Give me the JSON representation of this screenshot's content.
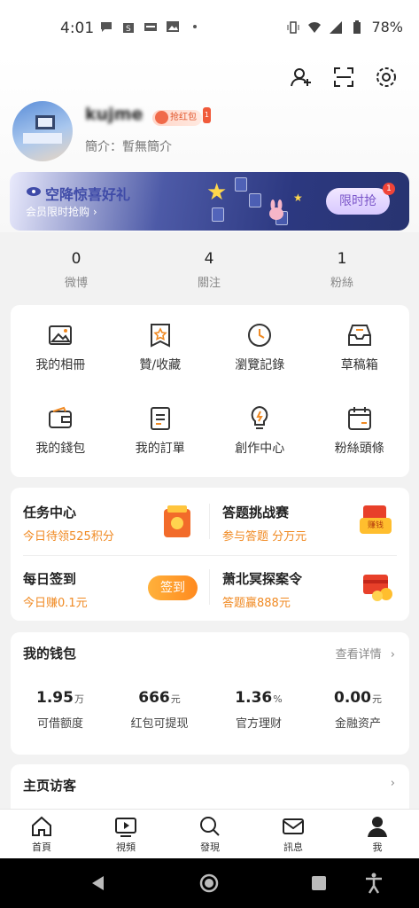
{
  "status_bar": {
    "time": "4:01",
    "battery": "78%",
    "icons": [
      "chat-icon",
      "shopping-bag-icon",
      "calendar-icon",
      "image-icon",
      "dot-icon",
      "vibrate-icon",
      "wifi-icon",
      "signal-icon",
      "battery-icon"
    ]
  },
  "header": {
    "actions": [
      "add-friend-icon",
      "scan-icon",
      "settings-icon"
    ],
    "username": "kujme",
    "badge_label": "抢红包",
    "badge_tag": "1",
    "bio": "簡介：暫無簡介"
  },
  "banner": {
    "title": "空降惊喜好礼",
    "subtitle": "会员限时抢购 ›",
    "button": "限时抢",
    "button_badge": "1"
  },
  "stats": [
    {
      "value": "0",
      "label": "微博"
    },
    {
      "value": "4",
      "label": "關注"
    },
    {
      "value": "1",
      "label": "粉絲"
    }
  ],
  "grid_items": [
    {
      "label": "我的相冊",
      "icon": "photo-album-icon"
    },
    {
      "label": "贊/收藏",
      "icon": "star-bookmark-icon"
    },
    {
      "label": "瀏覽記錄",
      "icon": "history-clock-icon"
    },
    {
      "label": "草稿箱",
      "icon": "draft-box-icon"
    },
    {
      "label": "我的錢包",
      "icon": "wallet-icon"
    },
    {
      "label": "我的訂單",
      "icon": "order-list-icon"
    },
    {
      "label": "創作中心",
      "icon": "creator-bulb-icon"
    },
    {
      "label": "粉絲頭條",
      "icon": "fans-headline-icon"
    }
  ],
  "tasks": {
    "task_center": {
      "title": "任务中心",
      "subtitle": "今日待领525积分"
    },
    "quiz": {
      "title": "答题挑战赛",
      "subtitle": "参与答题 分万元",
      "badge": "赚钱"
    },
    "daily_checkin": {
      "title": "每日签到",
      "subtitle": "今日赚0.1元",
      "button": "签到"
    },
    "detective": {
      "title": "萧北冥探案令",
      "subtitle": "答题赢888元"
    }
  },
  "wallet": {
    "title": "我的钱包",
    "more": "查看详情",
    "items": [
      {
        "value": "1.95",
        "unit": "万",
        "label": "可借额度"
      },
      {
        "value": "666",
        "unit": "元",
        "label": "红包可提现"
      },
      {
        "value": "1.36",
        "unit": "%",
        "label": "官方理财"
      },
      {
        "value": "0.00",
        "unit": "元",
        "label": "金融资产"
      }
    ]
  },
  "visitors": {
    "title": "主页访客"
  },
  "tabbar": [
    {
      "label": "首頁",
      "icon": "home-icon"
    },
    {
      "label": "視頻",
      "icon": "video-play-icon"
    },
    {
      "label": "發現",
      "icon": "discover-search-icon"
    },
    {
      "label": "訊息",
      "icon": "mail-icon"
    },
    {
      "label": "我",
      "icon": "profile-person-icon"
    }
  ],
  "colors": {
    "accent_orange": "#f08a23",
    "banner_dark": "#2c3880",
    "signin_button": "#ff8a1f"
  }
}
